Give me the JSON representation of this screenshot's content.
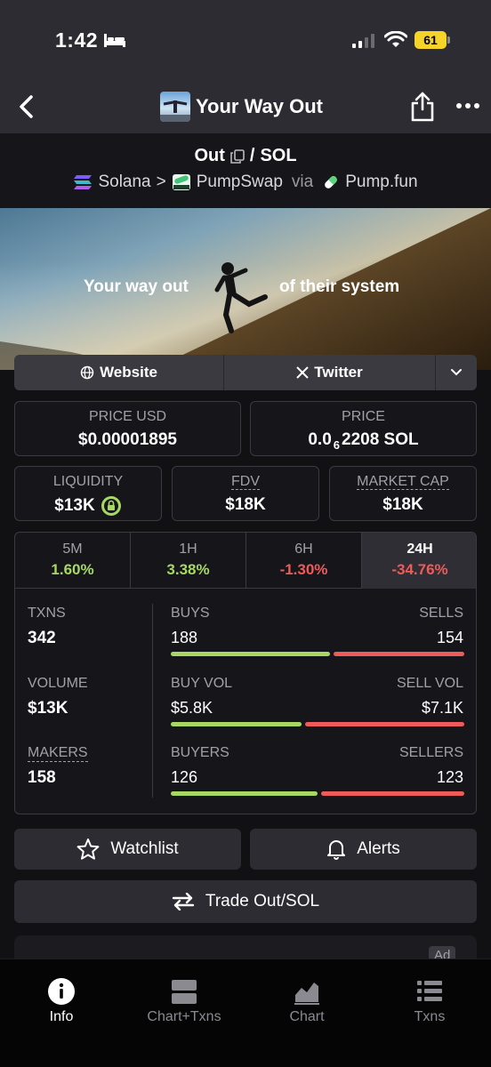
{
  "status_bar": {
    "time": "1:42",
    "battery": "61"
  },
  "nav": {
    "title": "Your Way Out"
  },
  "pair": {
    "base": "Out",
    "separator": "/",
    "quote": "SOL",
    "chain": "Solana",
    "chevron": ">",
    "dex": "PumpSwap",
    "via": "via",
    "launchpad": "Pump.fun"
  },
  "banner": {
    "text_left": "Your way out",
    "text_right": "of their system"
  },
  "links": {
    "website": "Website",
    "twitter": "Twitter"
  },
  "price": {
    "usd_label": "PRICE USD",
    "usd_value": "$0.00001895",
    "native_label": "PRICE",
    "native_prefix": "0.0",
    "native_subscript": "6",
    "native_suffix": "2208 SOL"
  },
  "stats": {
    "liquidity_label": "LIQUIDITY",
    "liquidity_value": "$13K",
    "fdv_label": "FDV",
    "fdv_value": "$18K",
    "mcap_label": "MARKET CAP",
    "mcap_value": "$18K"
  },
  "timeframes": [
    {
      "label": "5M",
      "change": "1.60%",
      "direction": "up"
    },
    {
      "label": "1H",
      "change": "3.38%",
      "direction": "up"
    },
    {
      "label": "6H",
      "change": "-1.30%",
      "direction": "down"
    },
    {
      "label": "24H",
      "change": "-34.76%",
      "direction": "down",
      "active": true
    }
  ],
  "metrics": {
    "txns_label": "TXNS",
    "txns_value": "342",
    "volume_label": "VOLUME",
    "volume_value": "$13K",
    "makers_label": "MAKERS",
    "makers_value": "158",
    "buys_label": "BUYS",
    "buys_value": "188",
    "sells_label": "SELLS",
    "sells_value": "154",
    "buy_vol_label": "BUY VOL",
    "buy_vol_value": "$5.8K",
    "sell_vol_label": "SELL VOL",
    "sell_vol_value": "$7.1K",
    "buyers_label": "BUYERS",
    "buyers_value": "126",
    "sellers_label": "SELLERS",
    "sellers_value": "123"
  },
  "ratios": {
    "buys_share": 0.55,
    "buy_vol_share": 0.45,
    "buyers_share": 0.506
  },
  "colors": {
    "positive": "#a6d863",
    "negative": "#ef5a5a",
    "background": "#111114"
  },
  "actions": {
    "watchlist": "Watchlist",
    "alerts": "Alerts",
    "trade": "Trade Out/SOL"
  },
  "ad": {
    "badge": "Ad"
  },
  "tabs": [
    {
      "label": "Info",
      "icon": "info-icon",
      "active": true
    },
    {
      "label": "Chart+Txns",
      "icon": "chart-txns-icon"
    },
    {
      "label": "Chart",
      "icon": "chart-icon"
    },
    {
      "label": "Txns",
      "icon": "list-icon"
    }
  ]
}
